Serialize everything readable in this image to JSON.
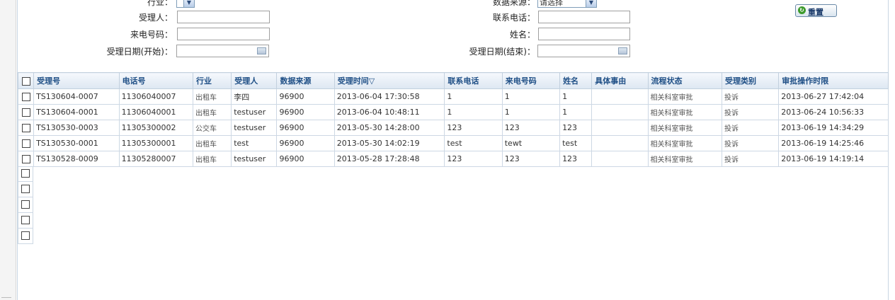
{
  "form": {
    "industry_label": "行业：",
    "data_source_label": "数据来源：",
    "data_source_value": "请选择",
    "handler_label": "受理人：",
    "contact_phone_label": "联系电话：",
    "caller_number_label": "来电号码：",
    "name_label": "姓名：",
    "start_date_label": "受理日期(开始)：",
    "end_date_label": "受理日期(结束)：",
    "reset_label": "重置"
  },
  "table": {
    "headers": [
      "受理号",
      "电话号",
      "行业",
      "受理人",
      "数据来源",
      "受理时间▽",
      "联系电话",
      "来电号码",
      "姓名",
      "具体事由",
      "流程状态",
      "受理类别",
      "审批操作时限"
    ],
    "rows": [
      [
        "TS130604-0007",
        "11306040007",
        "出租车",
        "李四",
        "96900",
        "2013-06-04 17:30:58",
        "1",
        "1",
        "1",
        "",
        "相关科室审批",
        "投诉",
        "2013-06-27 17:42:04"
      ],
      [
        "TS130604-0001",
        "11306040001",
        "出租车",
        "testuser",
        "96900",
        "2013-06-04 10:48:11",
        "1",
        "1",
        "1",
        "",
        "相关科室审批",
        "投诉",
        "2013-06-24 10:56:33"
      ],
      [
        "TS130530-0003",
        "11305300002",
        "公交车",
        "testuser",
        "96900",
        "2013-05-30 14:28:00",
        "123",
        "123",
        "123",
        "",
        "相关科室审批",
        "投诉",
        "2013-06-19 14:34:29"
      ],
      [
        "TS130530-0001",
        "11305300001",
        "出租车",
        "test",
        "96900",
        "2013-05-30 14:02:19",
        "test",
        "tewt",
        "test",
        "",
        "相关科室审批",
        "投诉",
        "2013-06-19 14:25:46"
      ],
      [
        "TS130528-0009",
        "11305280007",
        "出租车",
        "testuser",
        "96900",
        "2013-05-28 17:28:48",
        "123",
        "123",
        "123",
        "",
        "相关科室审批",
        "投诉",
        "2013-06-19 14:19:14"
      ]
    ],
    "empty_rows": 5
  }
}
